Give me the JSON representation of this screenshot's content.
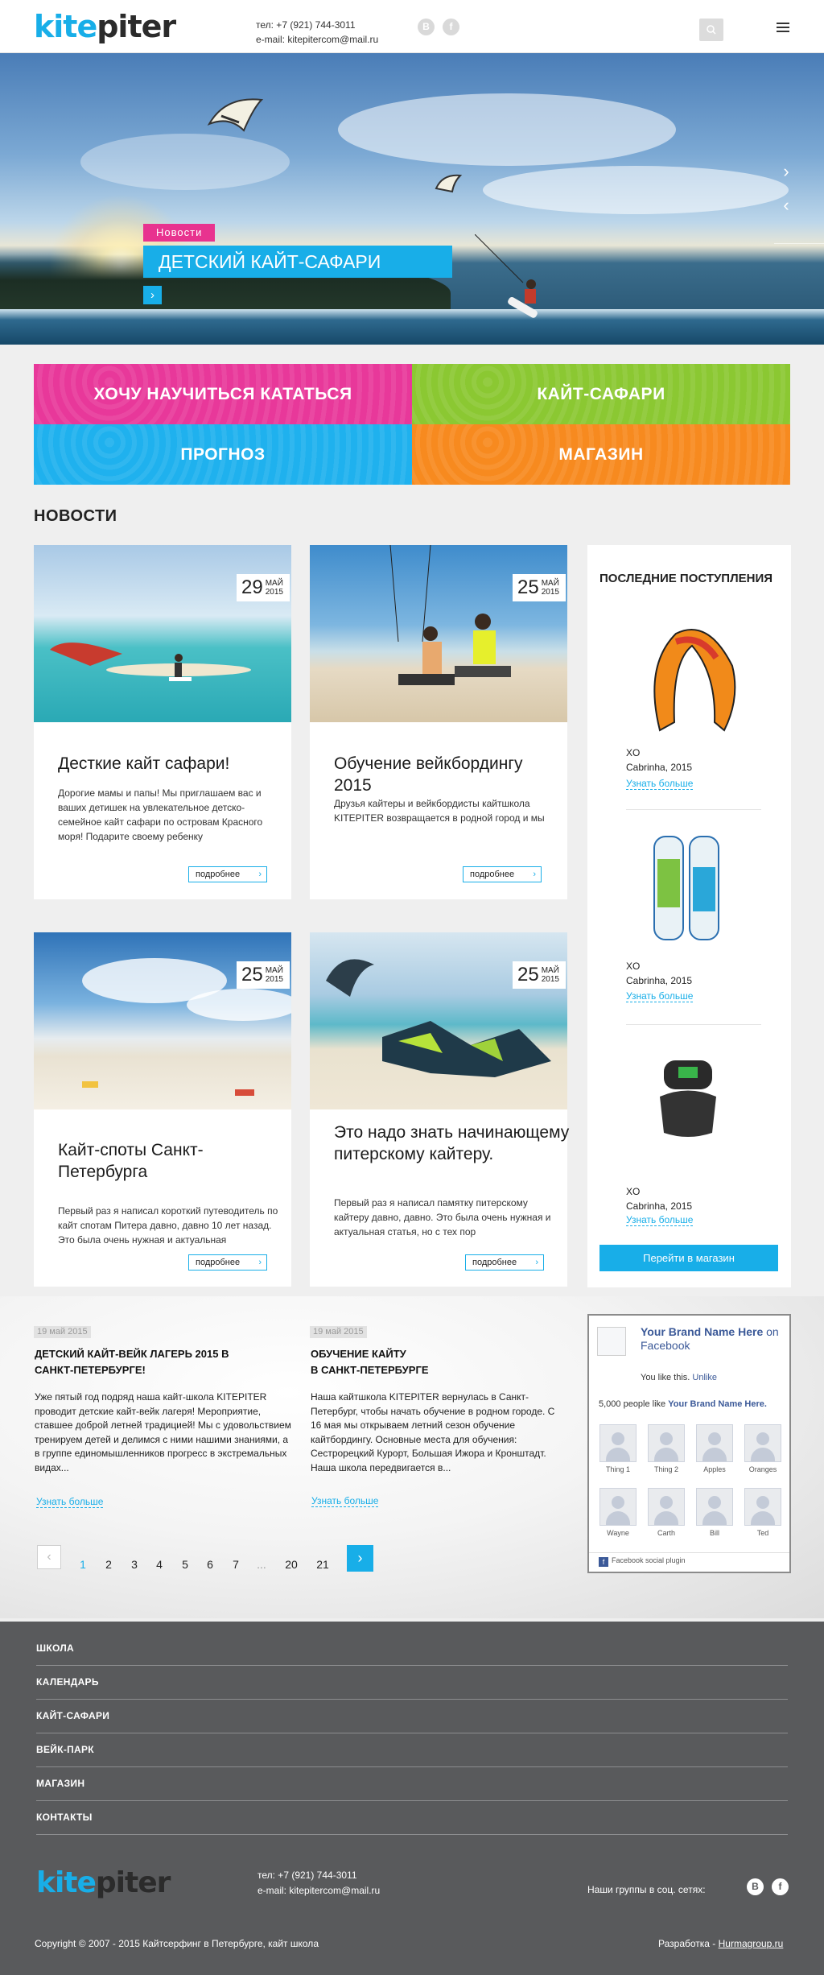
{
  "header": {
    "logo_part1": "kite",
    "logo_part2": "piter",
    "phone": "тел: +7 (921) 744-3011",
    "email": "e-mail: kitepitercom@mail.ru",
    "social": [
      "В",
      "f"
    ]
  },
  "hero": {
    "tag": "Новости",
    "title": "ДЕТСКИЙ КАЙТ-САФАРИ",
    "more_icon": "›",
    "next_icon": "›",
    "prev_icon": "‹",
    "slides_count": 6,
    "active_slide": 1
  },
  "tiles": [
    {
      "label": "ХОЧУ НАУЧИТЬСЯ КАТАТЬСЯ",
      "color": "#e8389a"
    },
    {
      "label": "КАЙТ-САФАРИ",
      "color": "#8bc832"
    },
    {
      "label": "ПРОГНОЗ",
      "color": "#1fb1ee"
    },
    {
      "label": "МАГАЗИН",
      "color": "#f78a1f"
    }
  ],
  "news": {
    "section_title": "НОВОСТИ",
    "more_label": "подробнее",
    "cards": [
      {
        "day": "29",
        "month": "МАЙ",
        "year": "2015",
        "title": "Десткие кайт сафари!",
        "text": "Дорогие мамы и папы! Мы приглашаем вас и ваших детишек на увлекательное детско-семейное кайт сафари по островам Красного моря! Подарите своему ребенку"
      },
      {
        "day": "25",
        "month": "МАЙ",
        "year": "2015",
        "title": "Обучение вейкбордингу 2015",
        "text": "Друзья кайтеры и вейкбордисты кайтшкола KITEPITER возвращается в родной город и мы снова будем учить не только"
      },
      {
        "day": "25",
        "month": "МАЙ",
        "year": "2015",
        "title": "Кайт-споты Санкт-Петербурга",
        "text": "Первый раз я написал короткий путеводитель по кайт спотам Питера давно, давно 10 лет назад. Это была очень нужная и актуальная"
      },
      {
        "day": "25",
        "month": "МАЙ",
        "year": "2015",
        "title": "Это надо знать начинающему питерскому кайтеру.",
        "text": "Первый раз я написал памятку питерскому кайтеру давно, давно. Это была очень нужная и актуальная статья, но с тех пор"
      }
    ]
  },
  "sidebar": {
    "title": "ПОСЛЕДНИЕ ПОСТУПЛЕНИЯ",
    "link_label": "Узнать больше",
    "products": [
      {
        "name": "XO",
        "sub": "Cabrinha, 2015"
      },
      {
        "name": "XO",
        "sub": "Cabrinha, 2015"
      },
      {
        "name": "XO",
        "sub": "Cabrinha, 2015"
      }
    ],
    "shop_button": "Перейти в магазин"
  },
  "text_news": [
    {
      "date": "19 май 2015",
      "title": "ДЕТСКИЙ КАЙТ-ВЕЙК ЛАГЕРЬ 2015 В САНКТ-ПЕТЕРБУРГЕ!",
      "text": "Уже пятый год подряд наша кайт-школа KITEPITER проводит детские кайт-вейк лагеря! Мероприятие, ставшее доброй летней традицией! Мы с удовольствием тренируем детей и делимся с ними нашими знаниями, а в группе единомышленников прогресс в экстремальных видах...",
      "link": "Узнать больше"
    },
    {
      "date": "19 май 2015",
      "title_line1": "ОБУЧЕНИЕ КАЙТУ",
      "title_line2": "В САНКТ-ПЕТЕРБУРГЕ",
      "text": "Наша кайтшкола KITEPITER вернулась в Санкт-Петербург, чтобы начать обучение в родном городе. С 16 мая мы открываем летний сезон обучение кайтбордингу. Основные места для обучения: Сестрорецкий Курорт, Большая Ижора и Кронштадт. Наша школа передвигается в...",
      "link": "Узнать больше"
    }
  ],
  "facebook": {
    "page_name": "Your Brand Name Here",
    "on_facebook": "on Facebook",
    "you_like": "You like this.",
    "unlike": "Unlike",
    "count_text": "5,000 people like",
    "count_brand": "Your Brand Name Here.",
    "friends": [
      "Thing 1",
      "Thing 2",
      "Apples",
      "Oranges",
      "Wayne",
      "Carth",
      "Bill",
      "Ted"
    ],
    "plugin_label": "Facebook social plugin"
  },
  "pagination": {
    "pages": [
      "1",
      "2",
      "3",
      "4",
      "5",
      "6",
      "7",
      "...",
      "20",
      "21"
    ],
    "prev_icon": "‹",
    "next_icon": "›"
  },
  "footer": {
    "menu": [
      "ШКОЛА",
      "КАЛЕНДАРЬ",
      "КАЙТ-САФАРИ",
      "ВЕЙК-ПАРК",
      "МАГАЗИН",
      "КОНТАКТЫ"
    ],
    "phone": "тел: +7 (921) 744-3011",
    "email": "e-mail: kitepitercom@mail.ru",
    "groups_label": "Наши группы в соц. сетях:",
    "social": [
      "В",
      "f"
    ],
    "copyright": "Copyright © 2007 - 2015 Кайтсерфинг в Петербурге, кайт школа",
    "dev_label": "Разработка - ",
    "dev_link": "Hurmagroup.ru"
  },
  "colors": {
    "accent": "#18aee8",
    "pink": "#e8338f",
    "footer_bg": "#595a5c"
  }
}
